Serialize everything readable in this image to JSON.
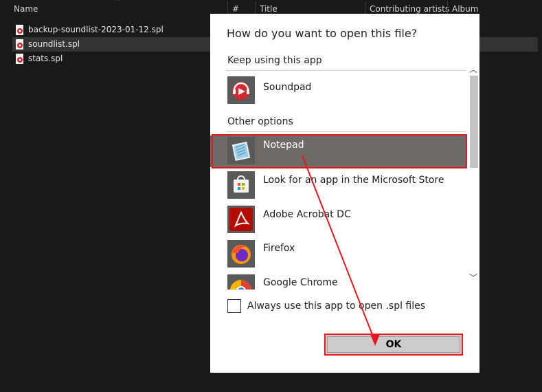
{
  "explorer": {
    "columns": {
      "name": "Name",
      "number": "#",
      "title": "Title",
      "contributing_artists": "Contributing artists",
      "album": "Album"
    },
    "files": [
      {
        "name": "backup-soundlist-2023-01-12.spl"
      },
      {
        "name": "soundlist.spl"
      },
      {
        "name": "stats.spl"
      }
    ]
  },
  "dialog": {
    "title": "How do you want to open this file?",
    "keep_using_label": "Keep using this app",
    "current_app": {
      "name": "Soundpad",
      "icon": "soundpad-icon"
    },
    "other_options_label": "Other options",
    "apps": [
      {
        "name": "Notepad",
        "icon": "notepad-icon"
      },
      {
        "name": "Look for an app in the Microsoft Store",
        "icon": "store-icon"
      },
      {
        "name": "Adobe Acrobat DC",
        "icon": "acrobat-icon"
      },
      {
        "name": "Firefox",
        "icon": "firefox-icon"
      },
      {
        "name": "Google Chrome",
        "icon": "chrome-icon"
      }
    ],
    "always_use_label": "Always use this app to open .spl files",
    "ok_label": "OK"
  },
  "colors": {
    "highlight_border": "#e8171f",
    "selected_row": "#6f6a66"
  }
}
